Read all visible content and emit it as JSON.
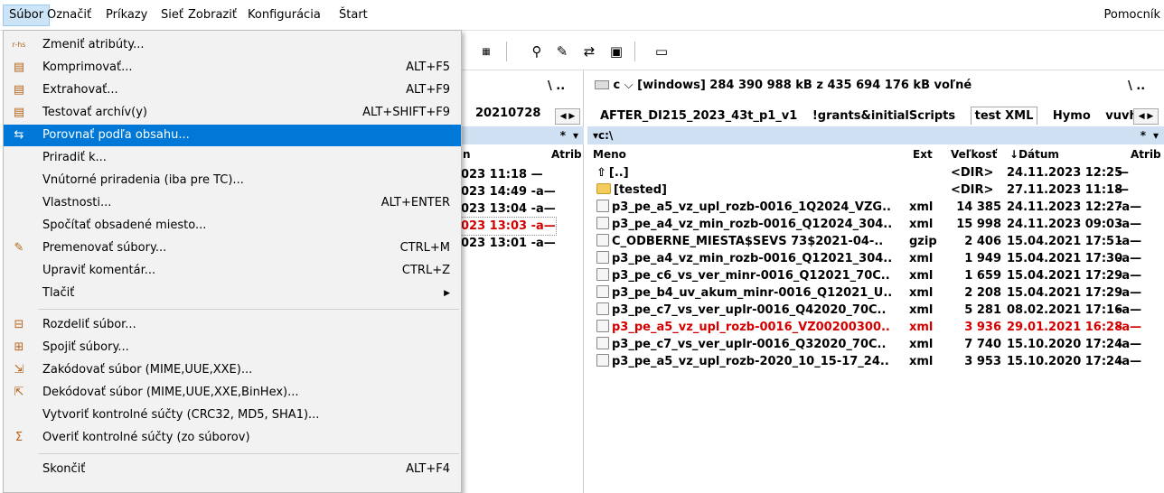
{
  "menubar": {
    "items": [
      "Súbor",
      "Označiť",
      "Príkazy",
      "Sieť",
      "Zobraziť",
      "Konfigurácia",
      "Štart"
    ],
    "help": "Pomocník"
  },
  "file_menu": [
    {
      "label": "Zmeniť atribúty...",
      "shortcut": "",
      "icon": "attributes-icon",
      "glyph": "r-hs"
    },
    {
      "label": "Komprimovať...",
      "shortcut": "ALT+F5",
      "icon": "pack-icon",
      "glyph": "▤"
    },
    {
      "label": "Extrahovať...",
      "shortcut": "ALT+F9",
      "icon": "unpack-icon",
      "glyph": "▤"
    },
    {
      "label": "Testovať archív(y)",
      "shortcut": "ALT+SHIFT+F9",
      "icon": "test-archive-icon",
      "glyph": "▤"
    },
    {
      "label": "Porovnať podľa obsahu...",
      "shortcut": "",
      "icon": "compare-icon",
      "glyph": "⇆"
    },
    {
      "label": "Priradiť k...",
      "shortcut": "",
      "icon": "",
      "glyph": ""
    },
    {
      "label": "Vnútorné priradenia (iba pre TC)...",
      "shortcut": "",
      "icon": "",
      "glyph": ""
    },
    {
      "label": "Vlastnosti...",
      "shortcut": "ALT+ENTER",
      "icon": "",
      "glyph": ""
    },
    {
      "label": "Spočítať obsadené miesto...",
      "shortcut": "",
      "icon": "",
      "glyph": ""
    },
    {
      "label": "Premenovať súbory...",
      "shortcut": "CTRL+M",
      "icon": "rename-icon",
      "glyph": "✎"
    },
    {
      "label": "Upraviť komentár...",
      "shortcut": "CTRL+Z",
      "icon": "",
      "glyph": ""
    },
    {
      "label": "Tlačiť",
      "shortcut": "▶",
      "icon": "",
      "glyph": ""
    },
    {
      "label": "Rozdeliť súbor...",
      "shortcut": "",
      "icon": "split-icon",
      "glyph": "⊟"
    },
    {
      "label": "Spojiť súbory...",
      "shortcut": "",
      "icon": "combine-icon",
      "glyph": "⊞"
    },
    {
      "label": "Zakódovať súbor (MIME,UUE,XXE)...",
      "shortcut": "",
      "icon": "encode-icon",
      "glyph": "⇲"
    },
    {
      "label": "Dekódovať súbor (MIME,UUE,XXE,BinHex)...",
      "shortcut": "",
      "icon": "decode-icon",
      "glyph": "⇱"
    },
    {
      "label": "Vytvoriť kontrolné súčty (CRC32, MD5, SHA1)...",
      "shortcut": "",
      "icon": "",
      "glyph": ""
    },
    {
      "label": "Overiť kontrolné súčty (zo súborov)",
      "shortcut": "",
      "icon": "checksum-icon",
      "glyph": "Σ"
    },
    {
      "label": "Skončiť",
      "shortcut": "ALT+F4",
      "icon": "",
      "glyph": ""
    }
  ],
  "left_panel": {
    "tab": "20210728",
    "sort_marker": "*",
    "col_atrib": "Atrib",
    "col_first": "n",
    "rows": [
      "023 11:18 —",
      "023 14:49 -a—",
      "023 13:04 -a—",
      "023 13:03 -a—",
      "023 13:01 -a—"
    ]
  },
  "right_panel": {
    "drive_letter": "c",
    "drive_info": "[windows]  284 390 988 kB z 435 694 176 kB voľné",
    "tabs": [
      "AFTER_DI215_2023_43t_p1_v1",
      "!grants&initialScripts",
      "test XML",
      "Hymo",
      "vuvh"
    ],
    "path": "▾c:\\",
    "sort_marker": "*",
    "columns": {
      "name": "Meno",
      "ext": "Ext",
      "size": "Veľkosť",
      "date": "Dátum",
      "attr": "Atrib"
    },
    "rows": [
      {
        "name": "[..]",
        "ext": "",
        "size": "<DIR>",
        "date": "24.11.2023 12:25",
        "attr": "—",
        "type": "up"
      },
      {
        "name": "[tested]",
        "ext": "",
        "size": "<DIR>",
        "date": "27.11.2023 11:18",
        "attr": "—",
        "type": "folder"
      },
      {
        "name": "p3_pe_a5_vz_upl_rozb-0016_1Q2024_VZG..",
        "ext": "xml",
        "size": "14 385",
        "date": "24.11.2023 12:27",
        "attr": "-a—",
        "type": "file"
      },
      {
        "name": "p3_pe_a4_vz_min_rozb-0016_Q12024_304..",
        "ext": "xml",
        "size": "15 998",
        "date": "24.11.2023 09:03",
        "attr": "-a—",
        "type": "file"
      },
      {
        "name": "C_ODBERNE_MIESTA$SEVS 73$2021-04-..",
        "ext": "gzip",
        "size": "2 406",
        "date": "15.04.2021 17:51",
        "attr": "-a—",
        "type": "file"
      },
      {
        "name": "p3_pe_a4_vz_min_rozb-0016_Q12021_304..",
        "ext": "xml",
        "size": "1 949",
        "date": "15.04.2021 17:30",
        "attr": "-a—",
        "type": "file"
      },
      {
        "name": "p3_pe_c6_vs_ver_minr-0016_Q12021_70C..",
        "ext": "xml",
        "size": "1 659",
        "date": "15.04.2021 17:29",
        "attr": "-a—",
        "type": "file"
      },
      {
        "name": "p3_pe_b4_uv_akum_minr-0016_Q12021_U..",
        "ext": "xml",
        "size": "2 208",
        "date": "15.04.2021 17:29",
        "attr": "-a—",
        "type": "file"
      },
      {
        "name": "p3_pe_c7_vs_ver_uplr-0016_Q42020_70C..",
        "ext": "xml",
        "size": "5 281",
        "date": "08.02.2021 17:16",
        "attr": "-a—",
        "type": "file"
      },
      {
        "name": "p3_pe_a5_vz_upl_rozb-0016_VZ00200300..",
        "ext": "xml",
        "size": "3 936",
        "date": "29.01.2021 16:28",
        "attr": "-a—",
        "type": "file",
        "red": true
      },
      {
        "name": "p3_pe_c7_vs_ver_uplr-0016_Q32020_70C..",
        "ext": "xml",
        "size": "7 740",
        "date": "15.10.2020 17:24",
        "attr": "-a—",
        "type": "file"
      },
      {
        "name": "p3_pe_a5_vz_upl_rozb-2020_10_15-17_24..",
        "ext": "xml",
        "size": "3 953",
        "date": "15.10.2020 17:24",
        "attr": "-a—",
        "type": "file"
      }
    ]
  },
  "colors": {
    "highlight": "#0078d7",
    "path_bar": "#cfe0f3",
    "red_text": "#d40000"
  }
}
